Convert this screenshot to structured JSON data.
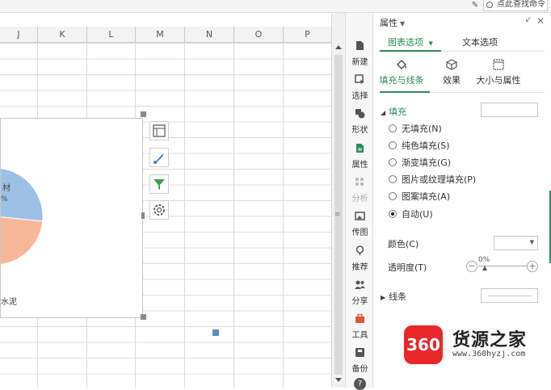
{
  "topbar": {
    "search_text": "点此查找命令"
  },
  "sheet": {
    "columns": [
      "J",
      "K",
      "L",
      "M",
      "N",
      "O",
      "P"
    ]
  },
  "chart": {
    "slice_top_label": "材",
    "slice_top_pct": "%",
    "slice_bottom_label": "水泥",
    "colors": {
      "slice_blue": "#9dc0e6",
      "slice_orange": "#f7b89a"
    }
  },
  "toolstrip": {
    "items": [
      {
        "label": "新建",
        "icon": "new-file-icon",
        "state": "normal"
      },
      {
        "label": "选择",
        "icon": "select-icon",
        "state": "normal"
      },
      {
        "label": "形状",
        "icon": "shape-icon",
        "state": "normal"
      },
      {
        "label": "属性",
        "icon": "properties-icon",
        "state": "active"
      },
      {
        "label": "分析",
        "icon": "analysis-icon",
        "state": "disabled"
      },
      {
        "label": "传图",
        "icon": "upload-image-icon",
        "state": "normal"
      },
      {
        "label": "推荐",
        "icon": "recommend-icon",
        "state": "normal"
      },
      {
        "label": "分享",
        "icon": "share-icon",
        "state": "normal"
      },
      {
        "label": "工具",
        "icon": "toolbox-icon",
        "state": "normal"
      },
      {
        "label": "备份",
        "icon": "backup-icon",
        "state": "normal"
      }
    ]
  },
  "panel": {
    "title": "属性",
    "tabs": [
      {
        "label": "图表选项",
        "selected": true
      },
      {
        "label": "文本选项",
        "selected": false
      }
    ],
    "subtabs": [
      {
        "label": "填充与线条",
        "selected": true
      },
      {
        "label": "效果",
        "selected": false
      },
      {
        "label": "大小与属性",
        "selected": false
      }
    ],
    "fill_section": "填充",
    "fill_options": [
      {
        "label": "无填充(N)",
        "checked": false
      },
      {
        "label": "纯色填充(S)",
        "checked": false
      },
      {
        "label": "渐变填充(G)",
        "checked": false
      },
      {
        "label": "图片或纹理填充(P)",
        "checked": false
      },
      {
        "label": "图案填充(A)",
        "checked": false
      },
      {
        "label": "自动(U)",
        "checked": true
      }
    ],
    "color_label": "颜色(C)",
    "transparency_label": "透明度(T)",
    "transparency_value": "0%",
    "line_section": "线条",
    "accent": "#2e8b57"
  },
  "watermark": {
    "badge": "360",
    "name": "货源之家",
    "url": "www.360hyzj.com"
  }
}
